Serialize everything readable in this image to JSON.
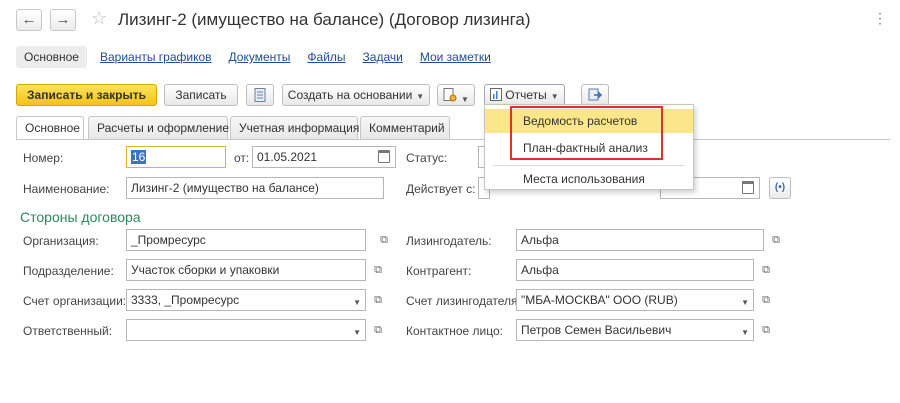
{
  "window": {
    "title": "Лизинг-2 (имущество на балансе) (Договор лизинга)",
    "back_glyph": "←",
    "forward_glyph": "→",
    "favorite_glyph": "☆",
    "more_glyph": "⋮"
  },
  "nav_panel": {
    "items": [
      "Основное",
      "Варианты графиков",
      "Документы",
      "Файлы",
      "Задачи",
      "Мои заметки"
    ]
  },
  "toolbar": {
    "save_close_label": "Записать и закрыть",
    "save_label": "Записать",
    "create_based_label": "Создать на основании",
    "reports_label": "Отчеты"
  },
  "reports_menu": {
    "items": [
      "Ведомость расчетов",
      "План-фактный анализ",
      "Места использования"
    ],
    "highlighted": "Ведомость расчетов"
  },
  "tabs": [
    "Основное",
    "Расчеты и оформление",
    "Учетная информация",
    "Комментарий"
  ],
  "form": {
    "number_label": "Номер:",
    "number_value": "16",
    "date_label": "от:",
    "date_value": "01.05.2021",
    "status_label": "Статус:",
    "name_label": "Наименование:",
    "name_value": "Лизинг-2 (имущество на балансе)",
    "valid_from_label": "Действует с:",
    "section_title": "Стороны договора",
    "organization_label": "Организация:",
    "organization_value": "_Промресурс",
    "division_label": "Подразделение:",
    "division_value": "Участок сборки и упаковки",
    "org_account_label": "Счет организации:",
    "org_account_value": "3333, _Промресурс",
    "responsible_label": "Ответственный:",
    "responsible_value": "",
    "lessor_label": "Лизингодатель:",
    "lessor_value": "Альфа",
    "counterparty_label": "Контрагент:",
    "counterparty_value": "Альфа",
    "lessor_account_label": "Счет лизингодателя:",
    "lessor_account_value": "\"МБА-МОСКВА\" ООО (RUB)",
    "contact_label": "Контактное лицо:",
    "contact_value": "Петров Семен Васильевич"
  },
  "colors": {
    "primary_button": "#f2c31a",
    "menu_highlight": "#fbe68a",
    "callout_border": "#e0312c",
    "section_title": "#2c8a5a",
    "link": "#1a4f99"
  }
}
